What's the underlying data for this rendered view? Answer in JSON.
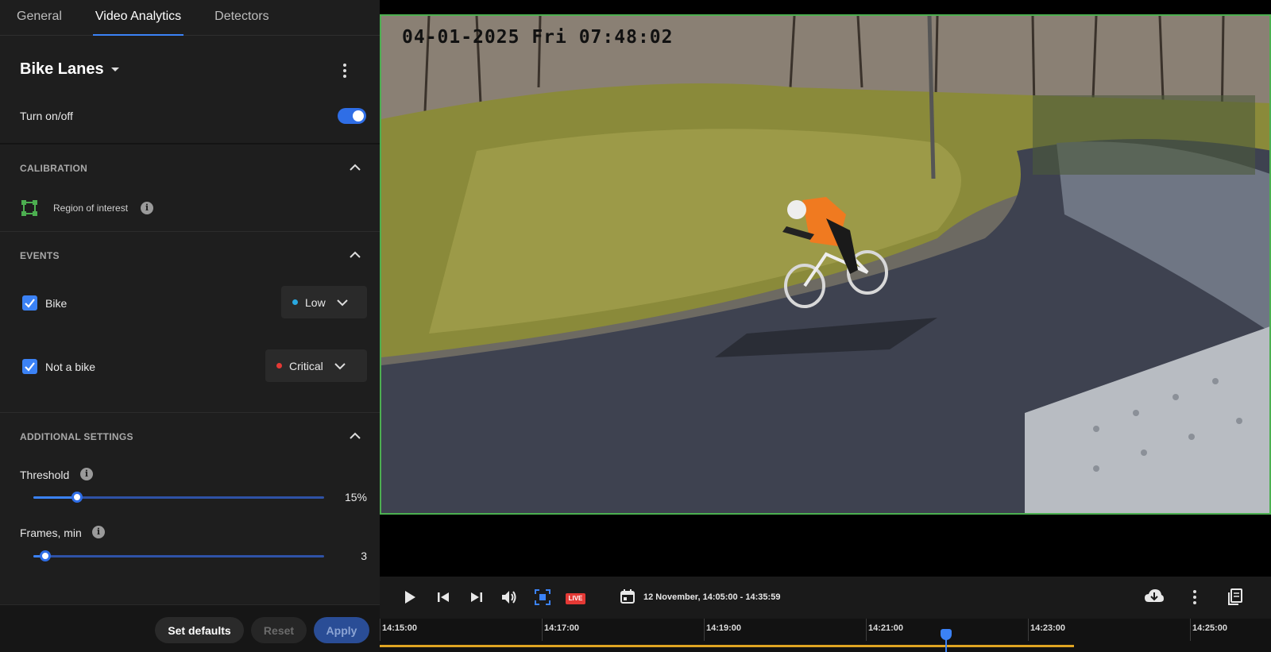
{
  "tabs": [
    {
      "label": "General",
      "active": false
    },
    {
      "label": "Video Analytics",
      "active": true
    },
    {
      "label": "Detectors",
      "active": false
    }
  ],
  "panel": {
    "title": "Bike Lanes",
    "toggle": {
      "label": "Turn on/off",
      "on": true
    },
    "calibration": {
      "header": "CALIBRATION",
      "roi_label": "Region of interest"
    },
    "events": {
      "header": "EVENTS",
      "items": [
        {
          "label": "Bike",
          "checked": true,
          "severity": "Low",
          "severity_color": "#29a8e0"
        },
        {
          "label": "Not a bike",
          "checked": true,
          "severity": "Critical",
          "severity_color": "#e53935"
        }
      ]
    },
    "additional": {
      "header": "ADDITIONAL SETTINGS",
      "threshold": {
        "label": "Threshold",
        "value_text": "15%",
        "value": 15,
        "min": 0,
        "max": 100
      },
      "frames": {
        "label": "Frames, min",
        "value_text": "3",
        "value": 3,
        "min": 1,
        "max": 50
      }
    },
    "buttons": {
      "set_defaults": "Set defaults",
      "reset": "Reset",
      "apply": "Apply"
    }
  },
  "video": {
    "osd_timestamp": "04-01-2025 Fri 07:48:02"
  },
  "player": {
    "live_label": "LIVE",
    "range": "12 November, 14:05:00 - 14:35:59"
  },
  "timeline": {
    "labels": [
      "14:15:00",
      "14:17:00",
      "14:19:00",
      "14:21:00",
      "14:23:00",
      "14:25:00"
    ]
  },
  "colors": {
    "accent": "#3b82f6",
    "roi_border": "#4caf50",
    "live": "#e53935",
    "timeline_fill": "#e0a422"
  }
}
